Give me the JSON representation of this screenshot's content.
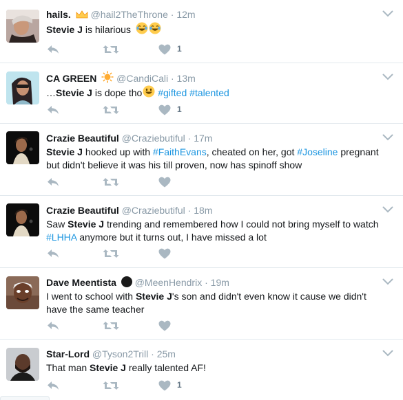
{
  "tweets": [
    {
      "name": "hails.",
      "name_emoji": "crown-emoji",
      "handle": "@hail2TheThrone",
      "dot": "·",
      "time": "12m",
      "text_pre": "",
      "text_bold": "Stevie J",
      "text_post": " is hilarious",
      "text_emoji": "laughing-tears-emoji x2",
      "likes": "1"
    },
    {
      "name": "CA GREEN",
      "name_emoji": "sun-emoji",
      "handle": "@CandiCali",
      "dot": "·",
      "time": "13m",
      "text_pre": "…",
      "text_bold": "Stevie J",
      "text_post": " is dope tho",
      "hashtags": [
        "#gifted",
        "#talented"
      ],
      "likes": "1"
    },
    {
      "name": "Crazie Beautiful",
      "handle": "@Craziebutiful",
      "dot": "·",
      "time": "17m",
      "text_bold": "Stevie J",
      "text_a": " hooked up with ",
      "hashtag_a": "#FaithEvans",
      "text_b": ", cheated on her, got ",
      "hashtag_b": "#Joseline",
      "text_c": " pregnant but didn't believe it was his till proven, now has spinoff show",
      "likes": ""
    },
    {
      "name": "Crazie Beautiful",
      "handle": "@Craziebutiful",
      "dot": "·",
      "time": "18m",
      "text_pre": "Saw ",
      "text_bold": "Stevie J",
      "text_a": " trending and remembered how I could not bring myself to watch ",
      "hashtag_a": "#LHHA",
      "text_b": " anymore but it turns out, I have missed a lot",
      "likes": ""
    },
    {
      "name": "Dave Meentista",
      "name_emoji": "black-circle",
      "handle": "@MeenHendrix",
      "dot": "·",
      "time": "19m",
      "text_pre": "I went to school with ",
      "text_bold": "Stevie J",
      "text_post": "'s son and didn't even know it cause we didn't have the same teacher",
      "likes": ""
    },
    {
      "name": "Star-Lord",
      "handle": "@Tyson2Trill",
      "dot": "·",
      "time": "25m",
      "text_pre": "That man ",
      "text_bold": "Stevie J",
      "text_post": " really talented AF!",
      "likes": "1"
    }
  ],
  "colors": {
    "hashtag": "#1b95e0",
    "meta": "#8899a6",
    "icon": "#aab8c2"
  }
}
